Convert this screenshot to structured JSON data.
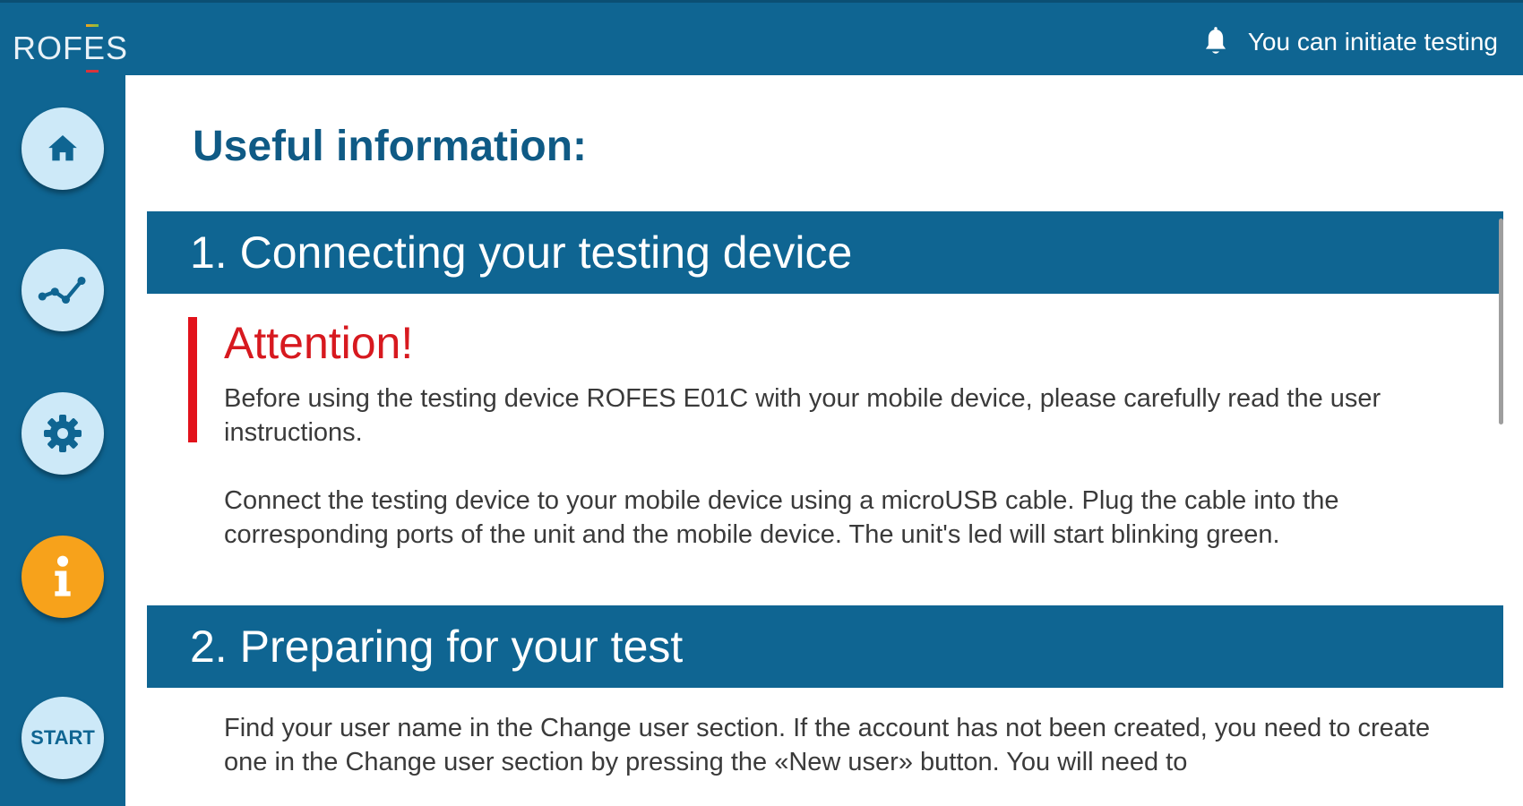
{
  "app": {
    "logo": "ROFES",
    "notification_text": "You can initiate testing"
  },
  "sidebar": {
    "items": [
      {
        "name": "home",
        "icon": "home-icon"
      },
      {
        "name": "history",
        "icon": "chart-line-icon"
      },
      {
        "name": "settings",
        "icon": "gear-icon"
      },
      {
        "name": "info",
        "icon": "info-icon",
        "active": true
      },
      {
        "name": "start",
        "label": "START"
      }
    ]
  },
  "main": {
    "title": "Useful information:",
    "sections": [
      {
        "header": "1. Connecting your testing device",
        "attention_title": "Attention!",
        "attention_text": "Before using the testing device ROFES E01C with your mobile device, please carefully read the user instructions.",
        "body": "Connect the testing device to your mobile device using a microUSB cable. Plug the cable into the corresponding ports of the unit and the mobile device. The unit's led will start blinking green."
      },
      {
        "header": "2. Preparing for your test",
        "body": "Find your user name in the Change user section. If the account has not been created, you need to create one in the Change user section by pressing the «New user» button. You will need to"
      }
    ]
  },
  "colors": {
    "primary": "#0f6592",
    "active": "#f7a21b",
    "nav_button": "#cde9f8",
    "attention": "#d7191f",
    "title": "#0f5a85"
  }
}
